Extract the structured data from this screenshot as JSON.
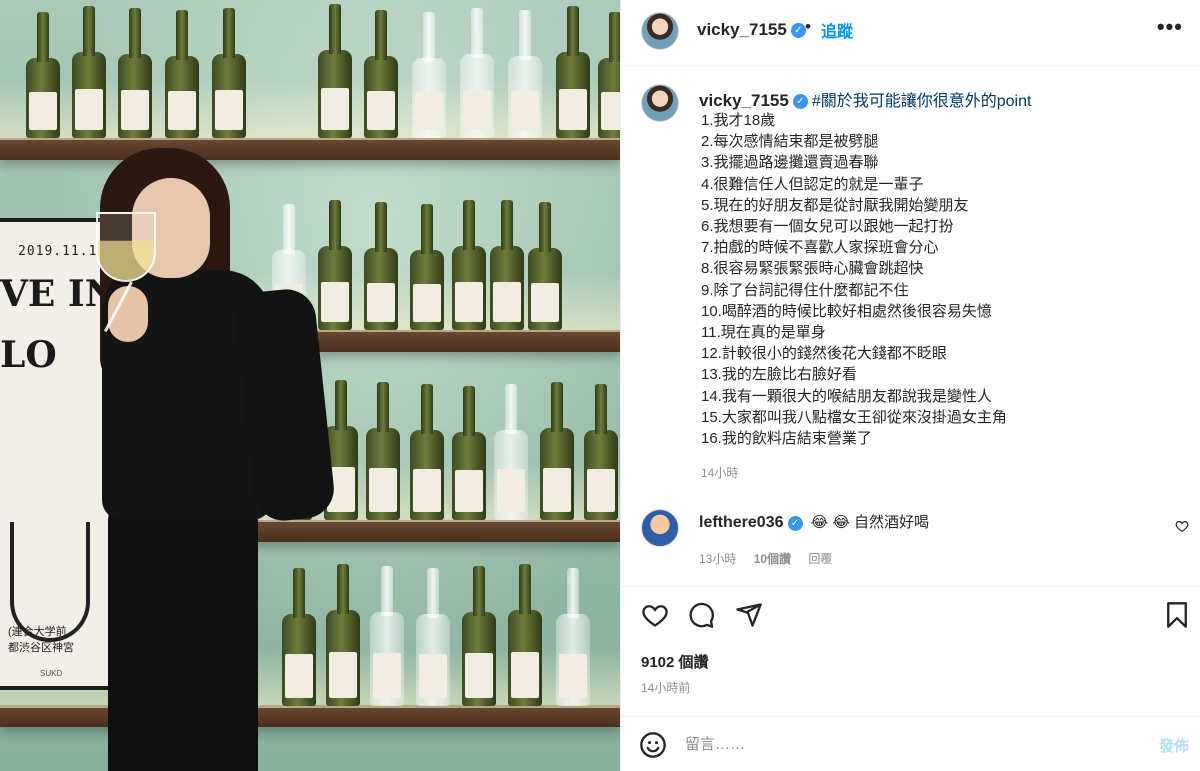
{
  "post": {
    "author": "vicky_7155",
    "follow_label": "追蹤",
    "more_label": "•••",
    "caption": {
      "hashtag": "#關於我可能讓你很意外的point",
      "lines": [
        "1.我才18歲",
        "2.每次感情結束都是被劈腿",
        "3.我擺過路邊攤還賣過春聯",
        "4.很難信任人但認定的就是一輩子",
        "5.現在的好朋友都是從討厭我開始變朋友",
        "6.我想要有一個女兒可以跟她一起打扮",
        "7.拍戲的時候不喜歡人家探班會分心",
        "8.很容易緊張緊張時心臟會跳超快",
        "9.除了台詞記得住什麼都記不住",
        "10.喝醉酒的時候比較好相處然後很容易失憶",
        "11.現在真的是單身",
        "12.計較很小的錢然後花大錢都不眨眼",
        "13.我的左臉比右臉好看",
        "14.我有一顆很大的喉結朋友都說我是變性人",
        "15.大家都叫我八點檔女王卻從來沒掛過女主角",
        "16.我的飲料店結束營業了"
      ],
      "time": "14小時"
    },
    "comment": {
      "user": "lefthere036",
      "text": "😂 😂 自然酒好喝",
      "time": "13小時",
      "likes": "10個讚",
      "reply": "回覆"
    },
    "likes": "9102 個讚",
    "posted_time": "14小時前",
    "input_placeholder": "留言……",
    "post_label": "發佈"
  },
  "photo": {
    "poster_date": "2019.11.1",
    "poster_big": "VE IN LO",
    "poster_foot": "(連合大学前\n都渋谷区神宮",
    "poster_sub": "SUKD"
  },
  "colors": {
    "accent": "#0095f6",
    "verified": "#3897f0",
    "hashtag": "#00376b",
    "muted": "#8e8e8e",
    "post_disabled": "#b2dffc"
  },
  "icons": [
    "verified-badge-icon",
    "more-icon",
    "heart-icon",
    "comment-icon",
    "share-icon",
    "bookmark-icon",
    "emoji-icon",
    "comment-like-icon"
  ]
}
